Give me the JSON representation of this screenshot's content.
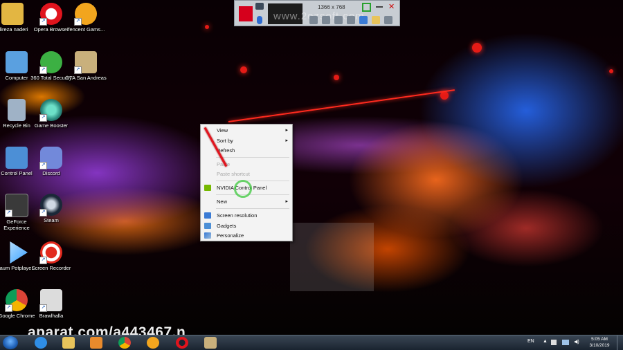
{
  "desktop_icons": [
    {
      "label": "alireza naderi",
      "icon": "user-folder-icon",
      "color": "#e3b642"
    },
    {
      "label": "Opera Browser",
      "icon": "opera-icon",
      "color": "#e0141d"
    },
    {
      "label": "Tencent Gams...",
      "icon": "tencent-gaming-icon",
      "color": "#f2a51e"
    },
    {
      "label": "Computer",
      "icon": "computer-icon",
      "color": "#5aa0e0"
    },
    {
      "label": "360 Total Security",
      "icon": "360-security-icon",
      "color": "#3cb043"
    },
    {
      "label": "GTA San Andreas",
      "icon": "gta-icon",
      "color": "#c9b07c"
    },
    {
      "label": "Recycle Bin",
      "icon": "recycle-bin-icon",
      "color": "#9fb2c6"
    },
    {
      "label": "Game Booster",
      "icon": "game-booster-icon",
      "color": "#2b8a7e"
    },
    {
      "label": "Control Panel",
      "icon": "control-panel-icon",
      "color": "#4c8fd6"
    },
    {
      "label": "Discord",
      "icon": "discord-icon",
      "color": "#7289da"
    },
    {
      "label": "GeForce Experience",
      "icon": "geforce-icon",
      "color": "#3a3a3a"
    },
    {
      "label": "Steam",
      "icon": "steam-icon",
      "color": "#1b2838"
    },
    {
      "label": "Daum Potplayer...",
      "icon": "potplayer-icon",
      "color": "#3aa0ff"
    },
    {
      "label": "Screen Recorder",
      "icon": "screen-recorder-icon",
      "color": "#e22a1e"
    },
    {
      "label": "Google Chrome",
      "icon": "chrome-icon",
      "color": "#f2c94c"
    },
    {
      "label": "Brawlhalla",
      "icon": "brawlhalla-icon",
      "color": "#dcdcdc"
    }
  ],
  "toolbar": {
    "resolution": "1366 x 768",
    "watermark": "www.2ozsoft.com",
    "close_glyph": "✕"
  },
  "context_menu": {
    "items": [
      {
        "label": "View",
        "submenu": true,
        "enabled": true,
        "icon": ""
      },
      {
        "label": "Sort by",
        "submenu": true,
        "enabled": true,
        "icon": ""
      },
      {
        "label": "Refresh",
        "submenu": false,
        "enabled": true,
        "icon": ""
      },
      {
        "label": "Paste",
        "submenu": false,
        "enabled": false,
        "icon": ""
      },
      {
        "label": "Paste shortcut",
        "submenu": false,
        "enabled": false,
        "icon": ""
      },
      {
        "label": "NVIDIA Control Panel",
        "submenu": false,
        "enabled": true,
        "icon": "nvidia-icon"
      },
      {
        "label": "New",
        "submenu": true,
        "enabled": true,
        "icon": ""
      },
      {
        "label": "Screen resolution",
        "submenu": false,
        "enabled": true,
        "icon": "screen-resolution-icon"
      },
      {
        "label": "Gadgets",
        "submenu": false,
        "enabled": true,
        "icon": "gadgets-icon"
      },
      {
        "label": "Personalize",
        "submenu": false,
        "enabled": true,
        "icon": "personalize-icon"
      }
    ],
    "submenu_arrow": "▸"
  },
  "watermark": "aparat.com/a443467.n",
  "taskbar": {
    "pinned": [
      {
        "name": "internet-explorer-icon",
        "color": "#2f8ee6"
      },
      {
        "name": "file-explorer-icon",
        "color": "#e8c45b"
      },
      {
        "name": "media-player-icon",
        "color": "#e88a2c"
      },
      {
        "name": "chrome-icon",
        "color": "#f2c94c"
      },
      {
        "name": "tencent-gaming-icon",
        "color": "#f2a51e"
      },
      {
        "name": "opera-icon",
        "color": "#e0141d"
      },
      {
        "name": "gta-icon",
        "color": "#c9b07c"
      }
    ],
    "language": "EN",
    "time": "5:05 AM",
    "date": "3/10/2019"
  }
}
